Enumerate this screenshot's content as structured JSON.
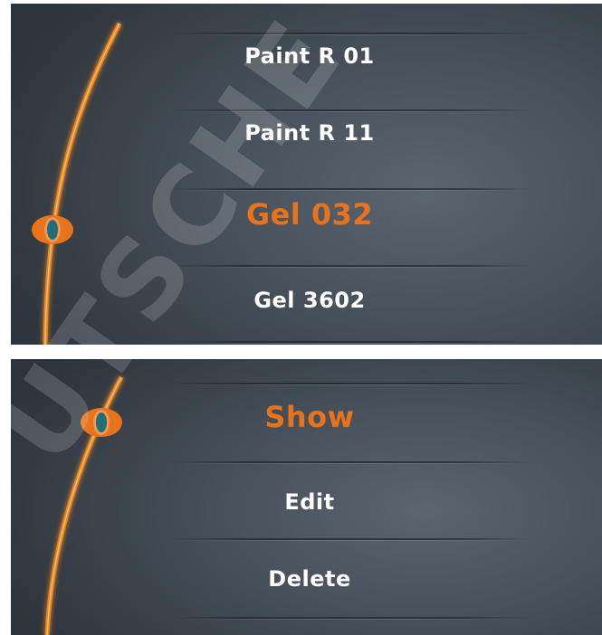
{
  "colors": {
    "accent": "#e8731a",
    "knob_center": "#1f6f7a",
    "text": "#ffffff"
  },
  "screen1": {
    "items": [
      {
        "label": "Paint R 01"
      },
      {
        "label": "Paint R 11"
      },
      {
        "label": "Gel 032",
        "selected": true
      },
      {
        "label": "Gel 3602"
      }
    ]
  },
  "screen2": {
    "items": [
      {
        "label": "Show",
        "selected": true
      },
      {
        "label": "Edit"
      },
      {
        "label": "Delete"
      }
    ]
  },
  "watermark": {
    "text": "UTSCHE"
  }
}
